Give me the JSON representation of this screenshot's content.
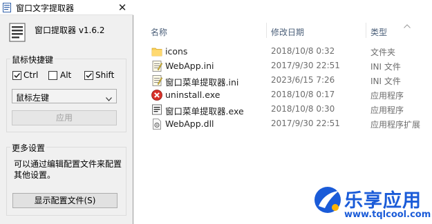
{
  "window": {
    "title": "窗口文字提取器",
    "close_glyph": "✕",
    "app_name": "窗口提取器 v1.6.2"
  },
  "hotkey_group": {
    "label": "鼠标快捷键",
    "checkboxes": [
      {
        "label": "Ctrl",
        "checked": true
      },
      {
        "label": "Alt",
        "checked": false
      },
      {
        "label": "Shift",
        "checked": true
      }
    ],
    "mouse_select_value": "鼠标左键",
    "apply_label": "应用"
  },
  "more_group": {
    "label": "更多设置",
    "note": "可以通过编辑配置文件来配置其他设置。",
    "show_config_label": "显示配置文件(S)"
  },
  "explorer": {
    "columns": {
      "name": "名称",
      "date": "修改日期",
      "type": "类型"
    },
    "files": [
      {
        "name": "icons",
        "date": "2018/10/8 0:32",
        "type": "文件夹",
        "icon": "folder-icon"
      },
      {
        "name": "WebApp.ini",
        "date": "2017/9/30 22:51",
        "type": "INI 文件",
        "icon": "ini-file-icon"
      },
      {
        "name": "窗口菜单提取器.ini",
        "date": "2023/6/15 7:26",
        "type": "INI 文件",
        "icon": "ini-file-icon"
      },
      {
        "name": "uninstall.exe",
        "date": "2018/10/8 0:17",
        "type": "应用程序",
        "icon": "uninstall-icon"
      },
      {
        "name": "窗口菜单提取器.exe",
        "date": "2018/10/8 0:30",
        "type": "应用程序",
        "icon": "app-exe-icon"
      },
      {
        "name": "WebApp.dll",
        "date": "2017/9/30 22:51",
        "type": "应用程序扩展",
        "icon": "dll-file-icon"
      }
    ]
  },
  "watermark": {
    "title": "乐享应用",
    "url": "www.tqlcool.com"
  },
  "colors": {
    "watermark_blue": "#1a5bd8",
    "header_text": "#4c607a"
  }
}
